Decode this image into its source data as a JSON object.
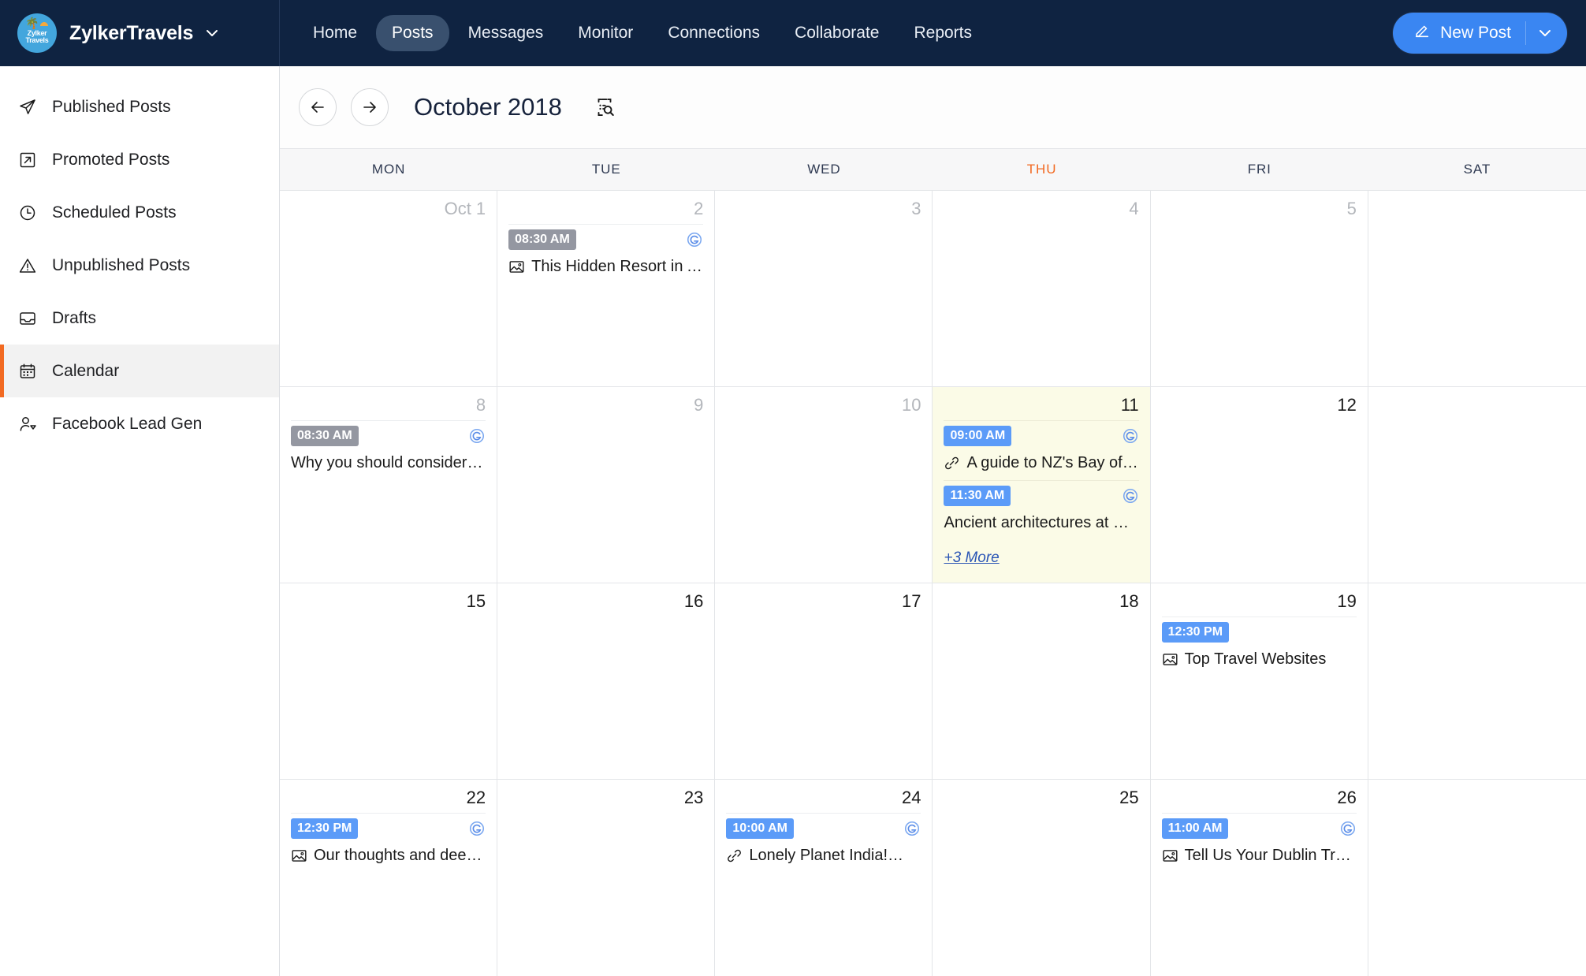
{
  "topbar": {
    "brand_name": "ZylkerTravels",
    "brand_logo_text": "Zylker Travels",
    "brand_caret_icon": "chevron-down-icon",
    "nav": [
      {
        "label": "Home",
        "active": false
      },
      {
        "label": "Posts",
        "active": true
      },
      {
        "label": "Messages",
        "active": false
      },
      {
        "label": "Monitor",
        "active": false
      },
      {
        "label": "Connections",
        "active": false
      },
      {
        "label": "Collaborate",
        "active": false
      },
      {
        "label": "Reports",
        "active": false
      }
    ],
    "new_post": {
      "label": "New Post",
      "icon": "pencil-icon",
      "caret_icon": "chevron-down-icon",
      "color": "#3a86f2"
    }
  },
  "sidebar": {
    "items": [
      {
        "label": "Published Posts",
        "icon": "send-icon",
        "active": false
      },
      {
        "label": "Promoted Posts",
        "icon": "external-link-icon",
        "active": false
      },
      {
        "label": "Scheduled Posts",
        "icon": "clock-icon",
        "active": false
      },
      {
        "label": "Unpublished Posts",
        "icon": "warning-icon",
        "active": false
      },
      {
        "label": "Drafts",
        "icon": "inbox-icon",
        "active": false
      },
      {
        "label": "Calendar",
        "icon": "calendar-icon",
        "active": true
      },
      {
        "label": "Facebook Lead Gen",
        "icon": "user-add-icon",
        "active": false
      }
    ],
    "active_accent": "#f26a22"
  },
  "calendar": {
    "title": "October 2018",
    "prev_icon": "arrow-left-icon",
    "next_icon": "arrow-right-icon",
    "search_icon": "content-search-icon",
    "today_accent": "#f26a22",
    "today_cell_bg": "#fbfbe7",
    "dow": [
      {
        "label": "MON",
        "today": false
      },
      {
        "label": "TUE",
        "today": false
      },
      {
        "label": "WED",
        "today": false
      },
      {
        "label": "THU",
        "today": true
      },
      {
        "label": "FRI",
        "today": false
      },
      {
        "label": "SAT",
        "today": false
      }
    ],
    "weeks": [
      [
        {
          "daynum": "Oct 1",
          "past": true,
          "today": false,
          "events": []
        },
        {
          "daynum": "2",
          "past": true,
          "today": false,
          "events": [
            {
              "time": "08:30 AM",
              "time_state": "past",
              "title": "This Hidden Resort in Ar…",
              "type_icon": "image-icon",
              "network_icon": "google-icon"
            }
          ]
        },
        {
          "daynum": "3",
          "past": true,
          "today": false,
          "events": []
        },
        {
          "daynum": "4",
          "past": true,
          "today": false,
          "events": []
        },
        {
          "daynum": "5",
          "past": true,
          "today": false,
          "events": []
        },
        {
          "daynum": "",
          "past": true,
          "today": false,
          "events": []
        }
      ],
      [
        {
          "daynum": "8",
          "past": true,
          "today": false,
          "events": [
            {
              "time": "08:30 AM",
              "time_state": "past",
              "title": "Why you should consider a …",
              "type_icon": "none",
              "network_icon": "google-icon"
            }
          ]
        },
        {
          "daynum": "9",
          "past": true,
          "today": false,
          "events": []
        },
        {
          "daynum": "10",
          "past": true,
          "today": false,
          "events": []
        },
        {
          "daynum": "11",
          "past": false,
          "today": true,
          "more_label": "+3 More",
          "events": [
            {
              "time": "09:00 AM",
              "time_state": "future",
              "title": "A guide to NZ's Bay of Is…",
              "type_icon": "link-icon",
              "network_icon": "google-icon"
            },
            {
              "time": "11:30 AM",
              "time_state": "future",
              "title": "Ancient architectures at Ka…",
              "type_icon": "none",
              "network_icon": "google-icon"
            }
          ]
        },
        {
          "daynum": "12",
          "past": false,
          "today": false,
          "events": []
        },
        {
          "daynum": "",
          "past": false,
          "today": false,
          "events": []
        }
      ],
      [
        {
          "daynum": "15",
          "past": false,
          "today": false,
          "events": []
        },
        {
          "daynum": "16",
          "past": false,
          "today": false,
          "events": []
        },
        {
          "daynum": "17",
          "past": false,
          "today": false,
          "events": []
        },
        {
          "daynum": "18",
          "past": false,
          "today": false,
          "events": []
        },
        {
          "daynum": "19",
          "past": false,
          "today": false,
          "events": [
            {
              "time": "12:30 PM",
              "time_state": "future",
              "title": "Top Travel Websites",
              "type_icon": "image-icon",
              "network_icon": "none"
            }
          ]
        },
        {
          "daynum": "",
          "past": false,
          "today": false,
          "events": []
        }
      ],
      [
        {
          "daynum": "22",
          "past": false,
          "today": false,
          "events": [
            {
              "time": "12:30 PM",
              "time_state": "future",
              "title": "Our thoughts and deepe…",
              "type_icon": "image-icon",
              "network_icon": "google-icon"
            }
          ]
        },
        {
          "daynum": "23",
          "past": false,
          "today": false,
          "events": []
        },
        {
          "daynum": "24",
          "past": false,
          "today": false,
          "events": [
            {
              "time": "10:00 AM",
              "time_state": "future",
              "title": "Lonely Planet India!…",
              "type_icon": "link-icon",
              "network_icon": "google-icon"
            }
          ]
        },
        {
          "daynum": "25",
          "past": false,
          "today": false,
          "events": []
        },
        {
          "daynum": "26",
          "past": false,
          "today": false,
          "events": [
            {
              "time": "11:00 AM",
              "time_state": "future",
              "title": "Tell Us Your Dublin Trav…",
              "type_icon": "image-icon",
              "network_icon": "google-icon"
            }
          ]
        },
        {
          "daynum": "",
          "past": false,
          "today": false,
          "events": []
        }
      ]
    ]
  }
}
